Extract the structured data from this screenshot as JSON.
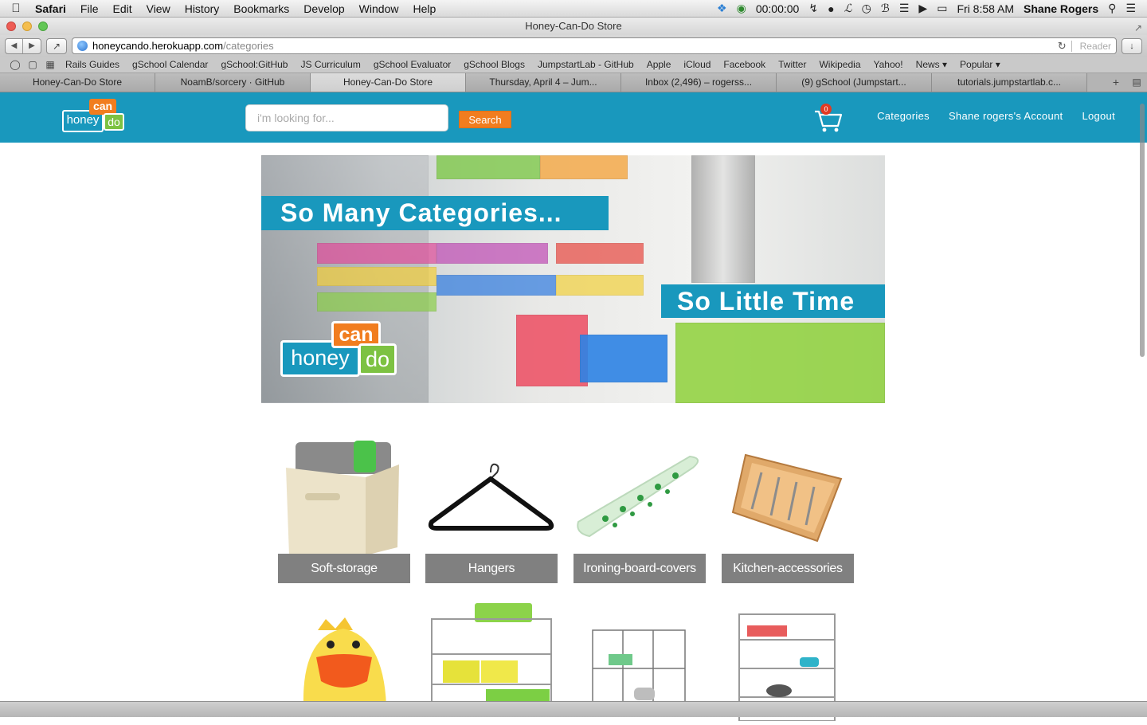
{
  "menubar": {
    "app": "Safari",
    "items": [
      "File",
      "Edit",
      "View",
      "History",
      "Bookmarks",
      "Develop",
      "Window",
      "Help"
    ],
    "timer": "00:00:00",
    "clock": "Fri 8:58 AM",
    "user": "Shane Rogers"
  },
  "window": {
    "title": "Honey-Can-Do Store"
  },
  "toolbar": {
    "url_host": "honeycando.herokuapp.com",
    "url_path": "/categories",
    "reader_label": "Reader"
  },
  "bookmarks": [
    "Rails Guides",
    "gSchool Calendar",
    "gSchool:GitHub",
    "JS Curriculum",
    "gSchool Evaluator",
    "gSchool Blogs",
    "JumpstartLab - GitHub",
    "Apple",
    "iCloud",
    "Facebook",
    "Twitter",
    "Wikipedia",
    "Yahoo!",
    "News ▾",
    "Popular ▾"
  ],
  "tabs": [
    {
      "label": "Honey-Can-Do Store",
      "active": false
    },
    {
      "label": "NoamB/sorcery · GitHub",
      "active": false
    },
    {
      "label": "Honey-Can-Do Store",
      "active": true
    },
    {
      "label": "Thursday, April 4 – Jum...",
      "active": false
    },
    {
      "label": "Inbox (2,496) – rogerss...",
      "active": false
    },
    {
      "label": "(9) gSchool (Jumpstart...",
      "active": false
    },
    {
      "label": "tutorials.jumpstartlab.c...",
      "active": false
    }
  ],
  "header": {
    "logo": {
      "honey": "honey",
      "can": "can",
      "do": "do"
    },
    "search_placeholder": "i'm looking for...",
    "search_button": "Search",
    "cart_count": "0",
    "nav": [
      "Categories",
      "Shane rogers's Account",
      "Logout"
    ],
    "brand_color": "#1998bd",
    "accent_color": "#f17d1f"
  },
  "banner": {
    "caption_top": "So Many Categories...",
    "caption_bottom": "So Little Time",
    "logo": {
      "honey": "honey",
      "can": "can",
      "do": "do"
    }
  },
  "categories": [
    {
      "label": "Soft-storage",
      "image": "fabric-storage-bin"
    },
    {
      "label": "Hangers",
      "image": "velvet-hanger"
    },
    {
      "label": "Ironing-board-covers",
      "image": "ironing-board-cover"
    },
    {
      "label": "Kitchen-accessories",
      "image": "bamboo-cutlery-tray"
    },
    {
      "label": "",
      "image": "kids-hamper"
    },
    {
      "label": "",
      "image": "wire-shelving-cart"
    },
    {
      "label": "",
      "image": "wire-cube-organizer"
    },
    {
      "label": "",
      "image": "steel-shelving-unit"
    }
  ]
}
